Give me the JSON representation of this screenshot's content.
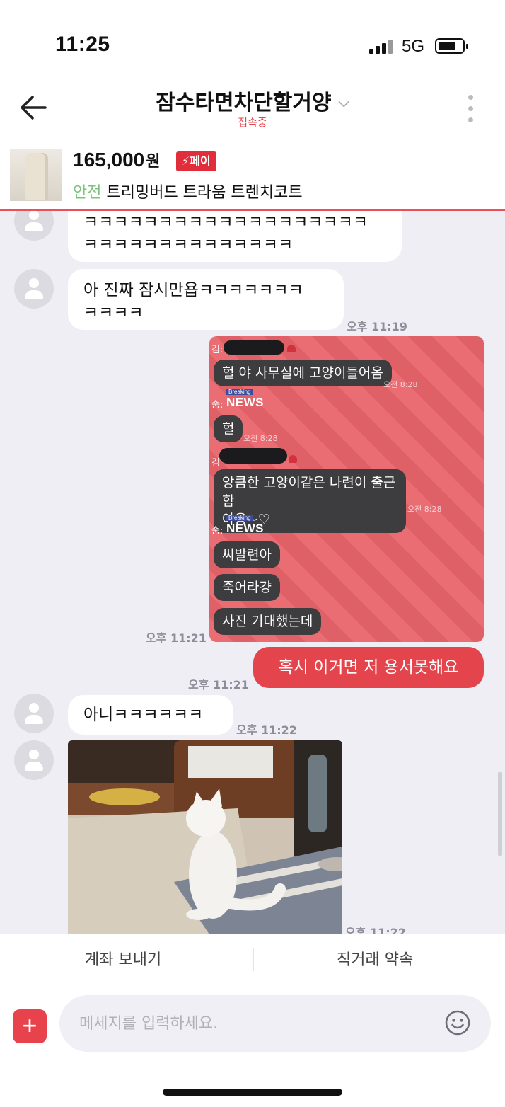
{
  "status": {
    "time": "11:25",
    "network": "5G"
  },
  "header": {
    "title": "잠수타면차단할거양",
    "status": "접속중"
  },
  "product": {
    "price": "165,000",
    "currency": "원",
    "pay_badge": "페이",
    "safe_label": "안전",
    "name": "트리밍버드 트라움 트렌치코트"
  },
  "messages": {
    "partial_line1": "ㅋㅋㅋㅋㅋㅋㅋㅋㅋㅋㅋㅋㅋㅋㅋㅋㅋㅋㅋ",
    "partial_line2": "ㅋㅋㅋㅋㅋㅋㅋㅋㅋㅋㅋㅋㅋㅋ",
    "m1_line1": "아 진짜 잠시만욥ㅋㅋㅋㅋㅋㅋㅋ",
    "m1_line2": "ㅋㅋㅋㅋ",
    "m1_time": "오후 11:19",
    "shot_time": "오후 11:21",
    "mine_text": "혹시 이거면 저 용서못해요",
    "mine_time": "오후 11:21",
    "m2_text": "아니ㅋㅋㅋㅋㅋㅋ",
    "m2_time": "오후 11:22",
    "photo_time": "오후 11:22"
  },
  "screenshot": {
    "n1": "김:",
    "b1": "헐 야 사무실에 고양이들어옴",
    "t1": "오전 8:28",
    "news_small": "Breaking",
    "news": "NEWS",
    "n2": "숨:",
    "b2": "헐",
    "t2": "오전 8:28",
    "n3": "김",
    "b3_line1": "앙큼한 고양이같은 나련이 출근함",
    "b3_line2": "야옹~♡",
    "t3": "오전 8:28",
    "n4": "숨:",
    "b4": "씨발련아",
    "b5": "죽어라걍",
    "b6": "사진 기대했는데"
  },
  "actions": {
    "send_account": "계좌 보내기",
    "direct_deal": "직거래 약속"
  },
  "input": {
    "placeholder": "메세지를 입력하세요."
  },
  "colors": {
    "accent": "#e4454c",
    "safe": "#7bc47a",
    "chat_bg": "#f0eef5"
  }
}
